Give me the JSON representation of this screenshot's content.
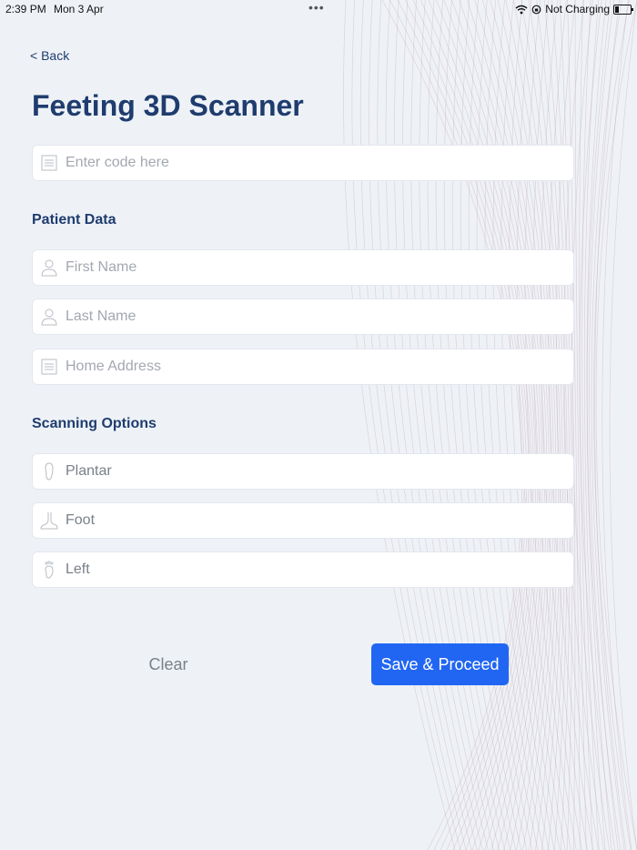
{
  "status_bar": {
    "time": "2:39 PM",
    "date": "Mon 3 Apr",
    "dots": "•••",
    "charging": "Not Charging"
  },
  "nav": {
    "back_label": "< Back"
  },
  "title": "Feeting 3D Scanner",
  "code_field": {
    "placeholder": "Enter code here",
    "icon": "list-icon"
  },
  "patient_data": {
    "heading": "Patient Data",
    "fields": [
      {
        "placeholder": "First Name",
        "icon": "person-icon"
      },
      {
        "placeholder": "Last Name",
        "icon": "person-icon"
      },
      {
        "placeholder": "Home Address",
        "icon": "list-icon"
      }
    ]
  },
  "scanning_options": {
    "heading": "Scanning Options",
    "options": [
      {
        "value": "Plantar",
        "icon": "insole-icon"
      },
      {
        "value": "Foot",
        "icon": "foot-side-icon"
      },
      {
        "value": "Left",
        "icon": "footprint-icon"
      }
    ]
  },
  "actions": {
    "clear_label": "Clear",
    "save_label": "Save & Proceed"
  },
  "colors": {
    "primary": "#2166f3",
    "heading": "#1f3c6e",
    "background": "#eef2f7"
  }
}
